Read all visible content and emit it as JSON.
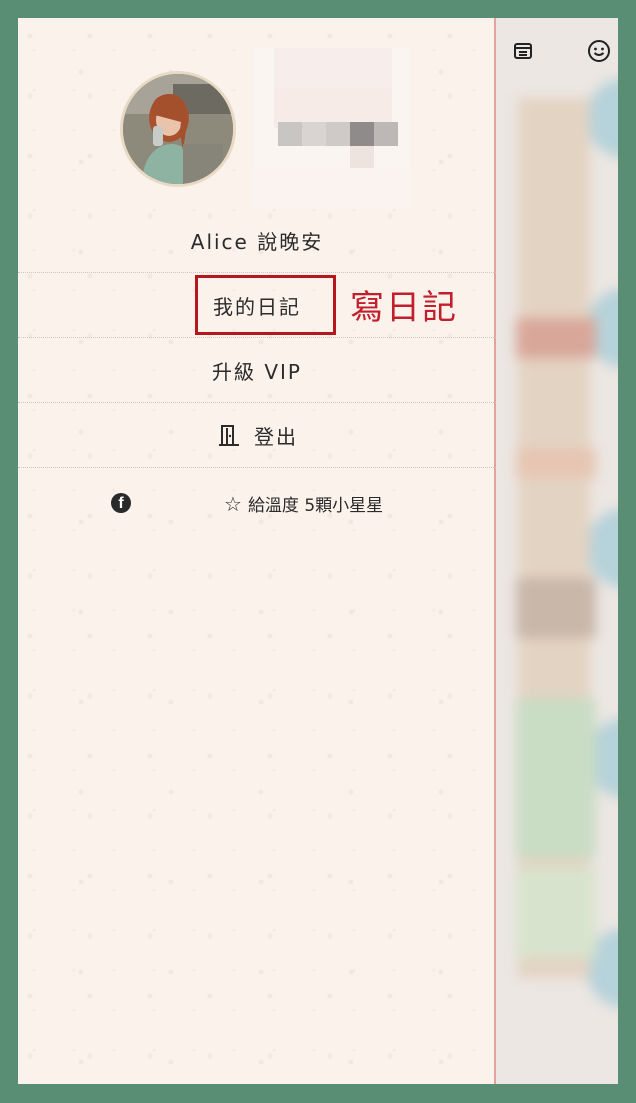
{
  "drawer": {
    "greeting": "Alice 說晚安",
    "menu": [
      {
        "label": "我的日記"
      },
      {
        "label": "升級 VIP"
      },
      {
        "label": "登出"
      }
    ],
    "annotation": "寫日記",
    "rate_label": "給溫度 5顆小星星",
    "fb_letter": "f"
  },
  "colors": {
    "frame": "#5a8e74",
    "drawer_bg": "#fbf2ec",
    "highlight": "#b6171d",
    "annotation": "#c21e2b"
  },
  "icons": [
    "top-bar-left-icon",
    "emoji-smile-icon",
    "logout-door-icon",
    "facebook-icon",
    "star-outline-icon"
  ]
}
